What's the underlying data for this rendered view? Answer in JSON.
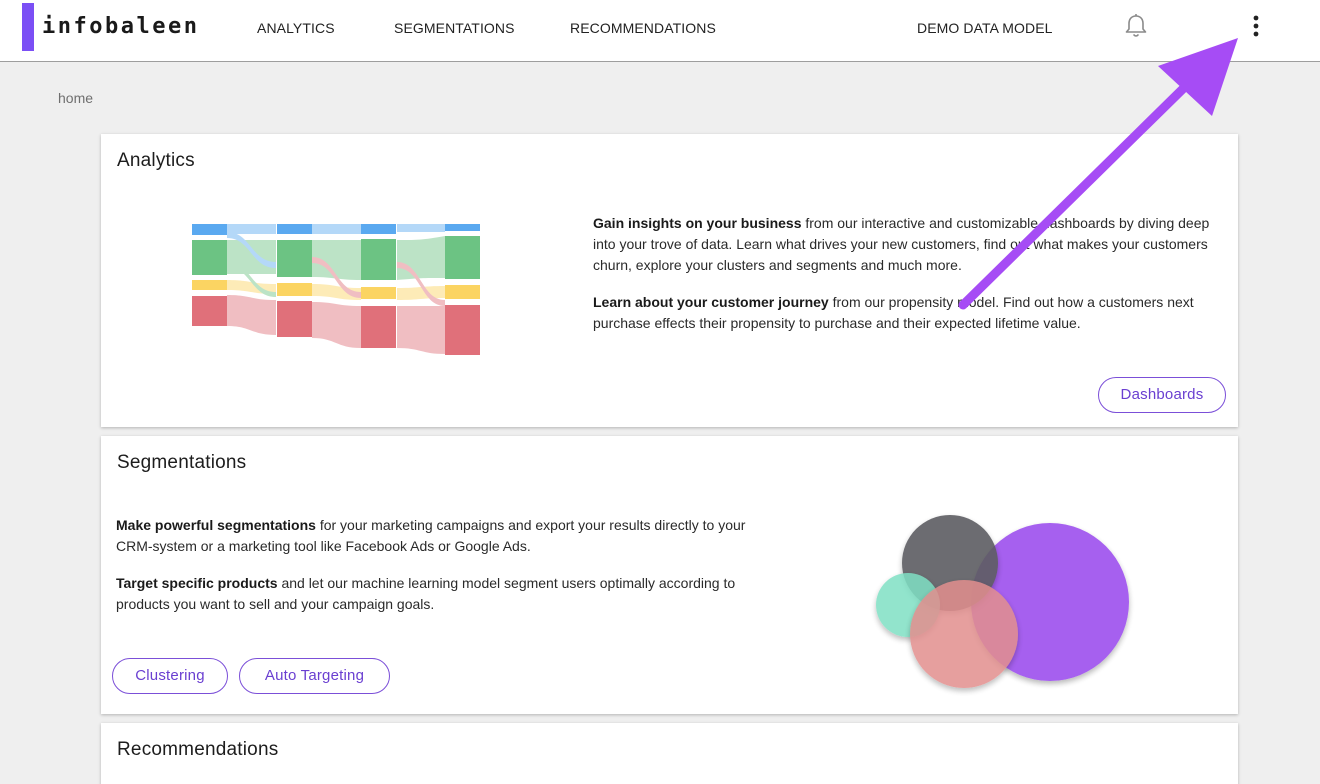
{
  "brand": {
    "name": "infobaleen",
    "accent": "#7b4ff5"
  },
  "nav": {
    "analytics": "ANALYTICS",
    "segmentations": "SEGMENTATIONS",
    "recommendations": "RECOMMENDATIONS",
    "data_model": "DEMO DATA MODEL"
  },
  "icons": {
    "notifications": "bell-icon",
    "more": "kebab-menu-icon"
  },
  "breadcrumb": "home",
  "analytics": {
    "title": "Analytics",
    "p1_bold": "Gain insights on your business",
    "p1_rest": " from our interactive and customizable dashboards by diving deep into your trove of data. Learn what drives your new customers, find out what makes your customers churn, explore your clusters and segments and much more.",
    "p2_bold": "Learn about your customer journey",
    "p2_rest": " from our propensity model. Find out how a customers next purchase effects their propensity to purchase and their expected lifetime value.",
    "button": "Dashboards"
  },
  "segmentations": {
    "title": "Segmentations",
    "p1_bold": "Make powerful segmentations",
    "p1_rest": " for your marketing campaigns and export your results directly to your CRM-system or a marketing tool like Facebook Ads or Google Ads.",
    "p2_bold": "Target specific products",
    "p2_rest": " and let our machine learning model segment users optimally according to products you want to sell and your campaign goals.",
    "button_clustering": "Clustering",
    "button_auto": "Auto Targeting"
  },
  "recommendations": {
    "title": "Recommendations"
  },
  "colors": {
    "sankey_blue": "#5aa9f0",
    "sankey_green": "#6cc383",
    "sankey_yellow": "#fbd462",
    "sankey_red": "#e0707a",
    "bubble_purple": "#9f52ee",
    "bubble_gray": "#5d5d62",
    "bubble_teal": "#7fe0c4",
    "bubble_pink": "#e28f8e",
    "annotation_arrow": "#a64cf5"
  }
}
